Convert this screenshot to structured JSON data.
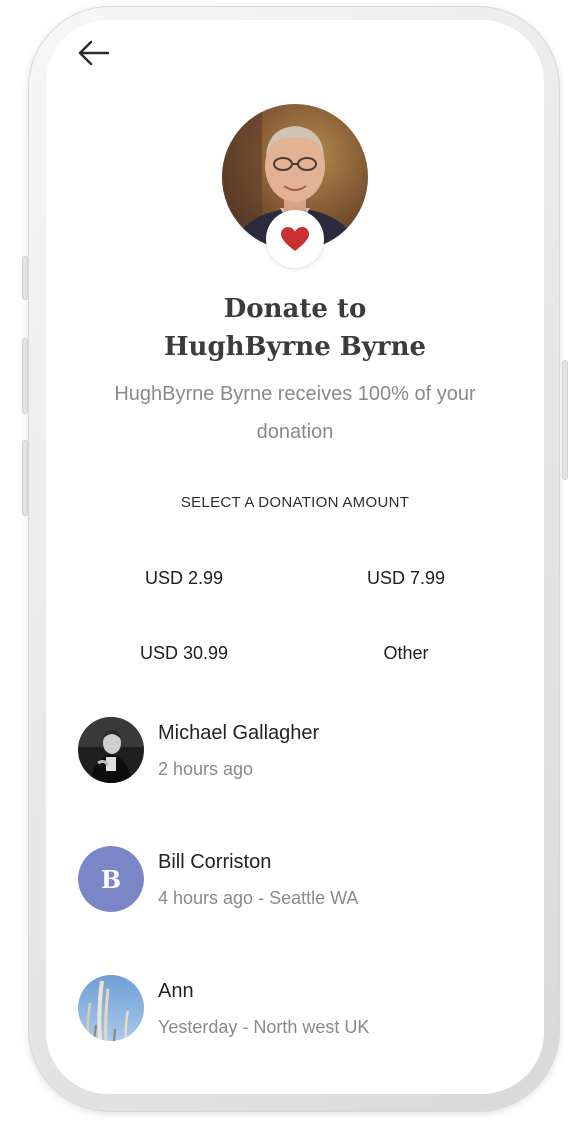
{
  "header": {
    "back_icon": "arrow-left-icon"
  },
  "recipient": {
    "badge_icon": "heart-icon",
    "title_line1": "Donate to",
    "title_line2": "HughByrne Byrne",
    "subtitle": "HughByrne Byrne receives 100% of your donation"
  },
  "donation": {
    "section_label": "SELECT A DONATION AMOUNT",
    "amounts": [
      "USD 2.99",
      "USD 7.99",
      "USD 30.99",
      "Other"
    ]
  },
  "donors": [
    {
      "name": "Michael Gallagher",
      "meta": "2 hours ago"
    },
    {
      "name": "Bill Corriston",
      "meta": "4 hours ago - Seattle WA",
      "initial": "B"
    },
    {
      "name": "Ann",
      "meta": "Yesterday - North west UK"
    }
  ],
  "colors": {
    "heart": "#c8312f",
    "initial_avatar": "#7b86c6"
  }
}
